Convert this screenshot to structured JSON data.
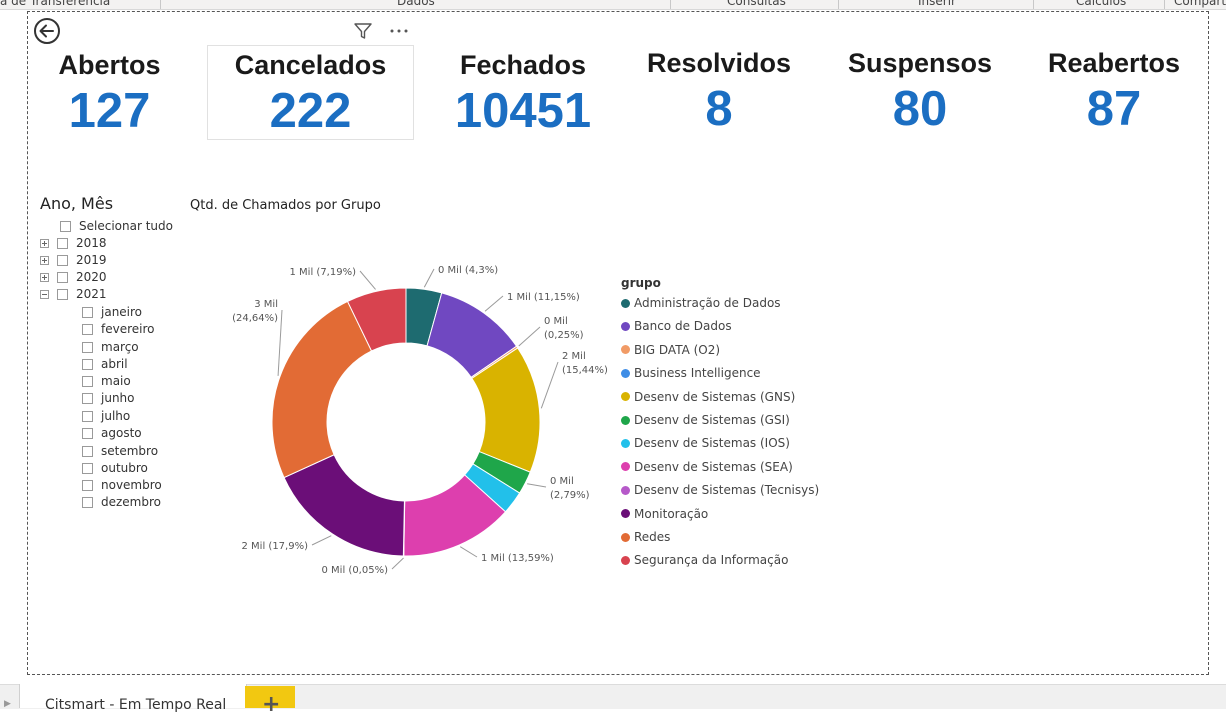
{
  "ribbon": {
    "groups": [
      "a de Transferência",
      "Dados",
      "Consultas",
      "Inserir",
      "Cálculos",
      "Comparti"
    ]
  },
  "kpis": [
    {
      "label": "Abertos",
      "value": "127"
    },
    {
      "label": "Cancelados",
      "value": "222"
    },
    {
      "label": "Fechados",
      "value": "10451"
    },
    {
      "label": "Resolvidos",
      "value": "8"
    },
    {
      "label": "Suspensos",
      "value": "80"
    },
    {
      "label": "Reabertos",
      "value": "87"
    }
  ],
  "slicer": {
    "title": "Ano, Mês",
    "select_all": "Selecionar tudo",
    "years": [
      "2018",
      "2019",
      "2020",
      "2021"
    ],
    "months": [
      "janeiro",
      "fevereiro",
      "março",
      "abril",
      "maio",
      "junho",
      "julho",
      "agosto",
      "setembro",
      "outubro",
      "novembro",
      "dezembro"
    ]
  },
  "page_tabs": {
    "current": "Citsmart - Em Tempo Real",
    "add_label": "+"
  },
  "chart_data": {
    "type": "pie",
    "title": "Qtd. de Chamados por Grupo",
    "legend_title": "grupo",
    "legend_position": "right",
    "slices": [
      {
        "name": "Administração de Dados",
        "percent": 4.3,
        "label": "0 Mil (4,3%)",
        "color": "#1e6b70"
      },
      {
        "name": "Banco de Dados",
        "percent": 11.15,
        "label": "1 Mil (11,15%)",
        "color": "#7048c1"
      },
      {
        "name": "BIG DATA (O2)",
        "percent": 0.25,
        "label": "0 Mil (0,25%)",
        "color": "#f19b66"
      },
      {
        "name": "Business Intelligence",
        "percent": 0.0,
        "label": "",
        "color": "#3e8de6"
      },
      {
        "name": "Desenv de Sistemas (GNS)",
        "percent": 15.44,
        "label": "2 Mil (15,44%)",
        "color": "#d9b300"
      },
      {
        "name": "Desenv de Sistemas (GSI)",
        "percent": 2.79,
        "label": "0 Mil (2,79%)",
        "color": "#1fa64a"
      },
      {
        "name": "Desenv de Sistemas (IOS)",
        "percent": 2.79,
        "label": "",
        "color": "#22c0ea"
      },
      {
        "name": "Desenv de Sistemas (SEA)",
        "percent": 13.59,
        "label": "1 Mil (13,59%)",
        "color": "#dd3fae"
      },
      {
        "name": "Desenv de Sistemas (Tecnisys)",
        "percent": 0.05,
        "label": "0 Mil (0,05%)",
        "color": "#b659c9"
      },
      {
        "name": "Monitoração",
        "percent": 17.9,
        "label": "2 Mil (17,9%)",
        "color": "#6b0e78"
      },
      {
        "name": "Redes",
        "percent": 24.64,
        "label": "3 Mil (24,64%)",
        "color": "#e26b35"
      },
      {
        "name": "Segurança da Informação",
        "percent": 7.19,
        "label": "1 Mil (7,19%)",
        "color": "#d8434f"
      }
    ]
  }
}
